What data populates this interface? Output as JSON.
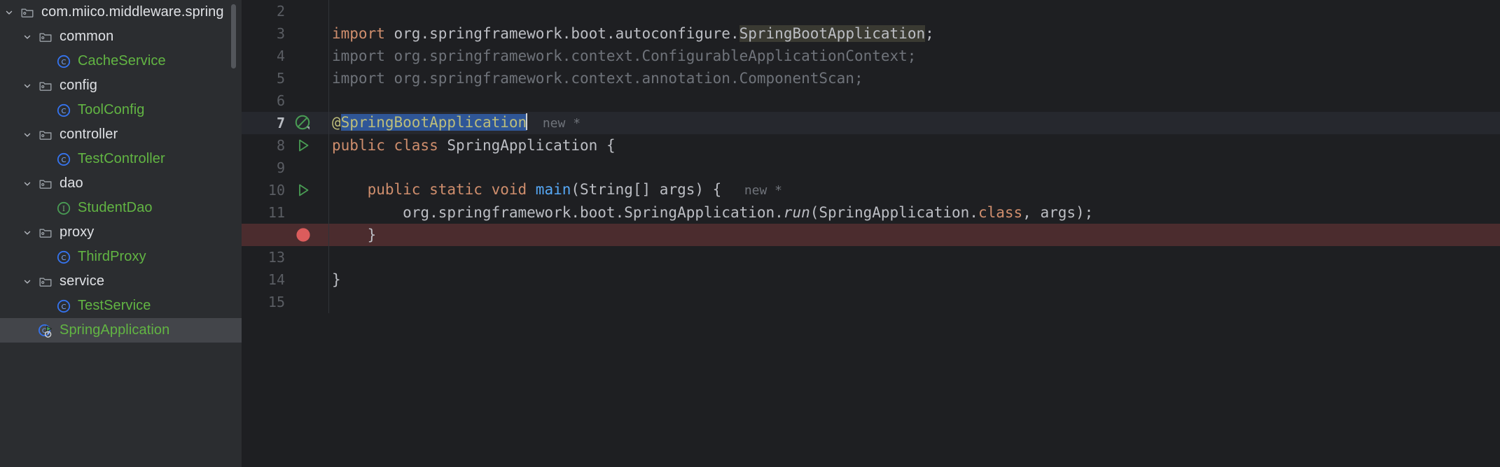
{
  "sidebar": {
    "scrollbar": "vertical-scrollbar",
    "tree": [
      {
        "label": "com.miico.middleware.spring",
        "kind": "package",
        "indent": 0,
        "expanded": true,
        "selected": false,
        "color": "default"
      },
      {
        "label": "common",
        "kind": "package",
        "indent": 1,
        "expanded": true,
        "selected": false,
        "color": "default"
      },
      {
        "label": "CacheService",
        "kind": "class",
        "indent": 2,
        "expanded": false,
        "selected": false,
        "color": "green"
      },
      {
        "label": "config",
        "kind": "package",
        "indent": 1,
        "expanded": true,
        "selected": false,
        "color": "default"
      },
      {
        "label": "ToolConfig",
        "kind": "class",
        "indent": 2,
        "expanded": false,
        "selected": false,
        "color": "green"
      },
      {
        "label": "controller",
        "kind": "package",
        "indent": 1,
        "expanded": true,
        "selected": false,
        "color": "default"
      },
      {
        "label": "TestController",
        "kind": "class",
        "indent": 2,
        "expanded": false,
        "selected": false,
        "color": "green"
      },
      {
        "label": "dao",
        "kind": "package",
        "indent": 1,
        "expanded": true,
        "selected": false,
        "color": "default"
      },
      {
        "label": "StudentDao",
        "kind": "interface",
        "indent": 2,
        "expanded": false,
        "selected": false,
        "color": "green"
      },
      {
        "label": "proxy",
        "kind": "package",
        "indent": 1,
        "expanded": true,
        "selected": false,
        "color": "default"
      },
      {
        "label": "ThirdProxy",
        "kind": "class",
        "indent": 2,
        "expanded": false,
        "selected": false,
        "color": "green"
      },
      {
        "label": "service",
        "kind": "package",
        "indent": 1,
        "expanded": true,
        "selected": false,
        "color": "default"
      },
      {
        "label": "TestService",
        "kind": "class",
        "indent": 2,
        "expanded": false,
        "selected": false,
        "color": "green"
      },
      {
        "label": "SpringApplication",
        "kind": "runnable-class",
        "indent": 1,
        "expanded": false,
        "selected": true,
        "color": "green"
      }
    ]
  },
  "editor": {
    "lines": [
      {
        "number": "2",
        "gutter_icon": "none",
        "row_style": "normal",
        "tokens": []
      },
      {
        "number": "3",
        "gutter_icon": "none",
        "row_style": "normal",
        "tokens": [
          {
            "t": "import ",
            "c": "kw"
          },
          {
            "t": "org.springframework.boot.autoconfigure.",
            "c": "plain"
          },
          {
            "t": "SpringBootApplication",
            "c": "hl"
          },
          {
            "t": ";",
            "c": "plain"
          }
        ]
      },
      {
        "number": "4",
        "gutter_icon": "none",
        "row_style": "normal",
        "tokens": [
          {
            "t": "import org.springframework.context.ConfigurableApplicationContext;",
            "c": "dim"
          }
        ]
      },
      {
        "number": "5",
        "gutter_icon": "none",
        "row_style": "normal",
        "tokens": [
          {
            "t": "import org.springframework.context.annotation.ComponentScan;",
            "c": "dim"
          }
        ]
      },
      {
        "number": "6",
        "gutter_icon": "none",
        "row_style": "normal",
        "tokens": []
      },
      {
        "number": "7",
        "gutter_icon": "spring-bean-icon",
        "row_style": "caretline",
        "tokens": [
          {
            "t": "@",
            "c": "ann"
          },
          {
            "t": "SpringBootApplication",
            "c": "sel"
          },
          {
            "t": "|caret|",
            "c": "caret"
          },
          {
            "t": "  new *",
            "c": "hint"
          }
        ]
      },
      {
        "number": "8",
        "gutter_icon": "run-icon",
        "row_style": "normal",
        "tokens": [
          {
            "t": "public class ",
            "c": "kw"
          },
          {
            "t": "SpringApplication {",
            "c": "plain"
          }
        ]
      },
      {
        "number": "9",
        "gutter_icon": "none",
        "row_style": "normal",
        "tokens": []
      },
      {
        "number": "10",
        "gutter_icon": "run-icon",
        "row_style": "normal",
        "tokens": [
          {
            "t": "    public static void ",
            "c": "kw"
          },
          {
            "t": "main",
            "c": "fn"
          },
          {
            "t": "(String[] args) {",
            "c": "plain"
          },
          {
            "t": "   new *",
            "c": "hint"
          }
        ]
      },
      {
        "number": "11",
        "gutter_icon": "none",
        "row_style": "normal",
        "tokens": [
          {
            "t": "        org.springframework.boot.SpringApplication.",
            "c": "plain"
          },
          {
            "t": "run",
            "c": "it"
          },
          {
            "t": "(SpringApplication.",
            "c": "plain"
          },
          {
            "t": "class",
            "c": "kw"
          },
          {
            "t": ", args);",
            "c": "plain"
          }
        ]
      },
      {
        "number": "",
        "gutter_icon": "breakpoint-icon",
        "row_style": "bp",
        "tokens": [
          {
            "t": "    }",
            "c": "plain"
          }
        ]
      },
      {
        "number": "13",
        "gutter_icon": "none",
        "row_style": "normal",
        "tokens": []
      },
      {
        "number": "14",
        "gutter_icon": "none",
        "row_style": "normal",
        "tokens": [
          {
            "t": "}",
            "c": "plain"
          }
        ]
      },
      {
        "number": "15",
        "gutter_icon": "none",
        "row_style": "normal",
        "tokens": []
      }
    ]
  },
  "colors": {
    "sidebar_bg": "#2b2d30",
    "editor_bg": "#1e1f22",
    "selection_blue": "#2f5697",
    "breakpoint_red": "#db5c5c",
    "run_green": "#499c54",
    "keyword_orange": "#cf8e6d",
    "method_blue": "#56a8f5",
    "annotation_yellow": "#bdbd7a",
    "class_green": "#62b543",
    "dim_gray": "#6f737a"
  }
}
